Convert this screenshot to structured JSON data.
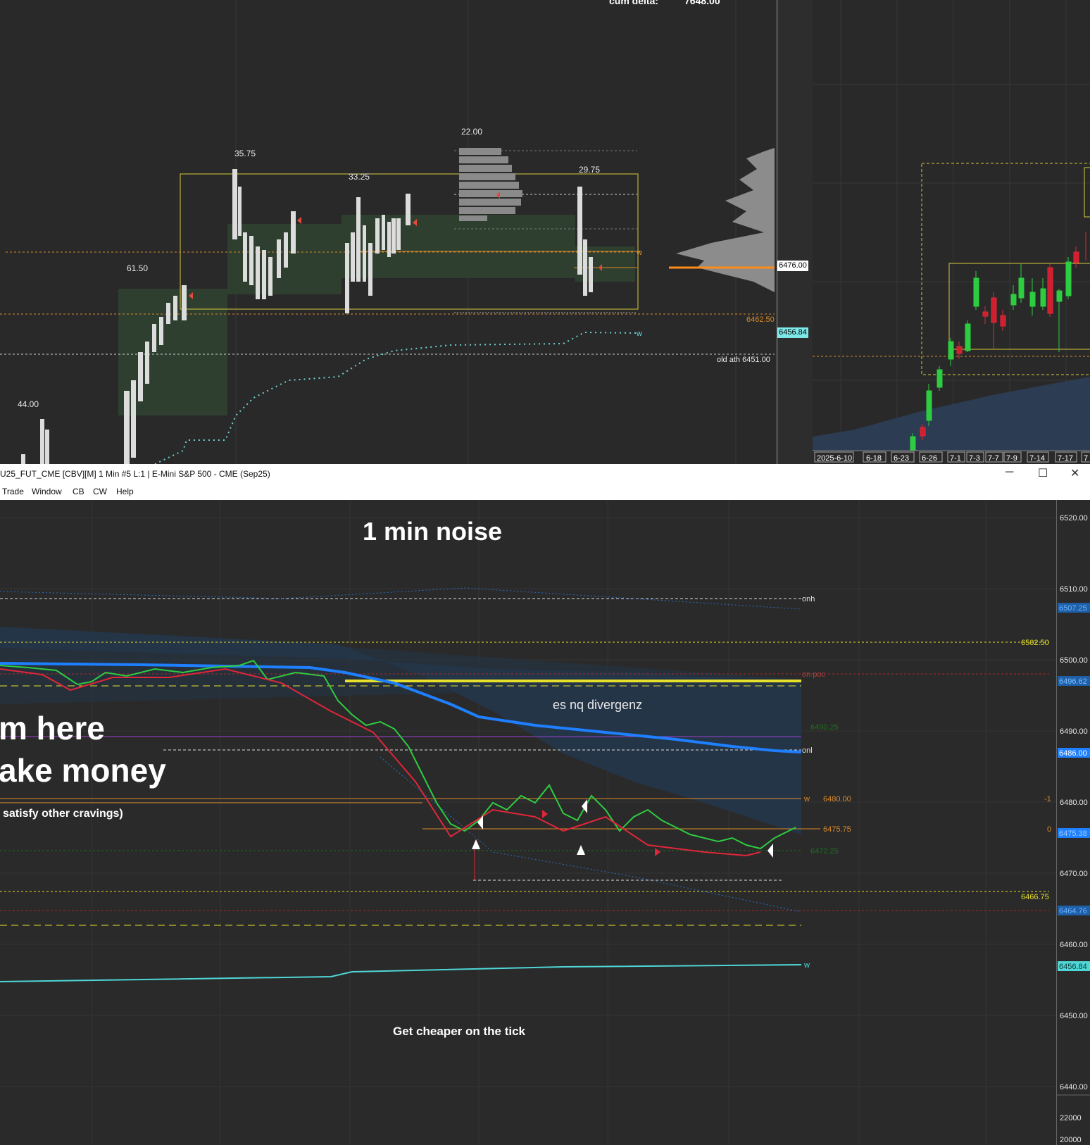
{
  "tpo_chart": {
    "cum_delta_label": "cum delta:",
    "cum_delta_value": "7648.00",
    "range_labels": [
      "35.75",
      "33.25",
      "22.00",
      "29.75",
      "61.50",
      "44.00"
    ],
    "price_tags": {
      "poc": "6476.00",
      "vwap": "6456.84"
    },
    "level_labels": {
      "level_6462": "6462.50",
      "old_ath": "old ath  6451.00"
    },
    "w_marker": "w"
  },
  "daily_chart": {
    "dates": [
      "2025-6-10",
      "6-18",
      "6-23",
      "6-26",
      "7-1",
      "7-3",
      "7-7",
      "7-9",
      "7-14",
      "7-17",
      "7"
    ]
  },
  "window": {
    "title": "U25_FUT_CME [CBV][M]  1 Min  #5 L:1 | E-Mini S&P 500 - CME (Sep25)",
    "menu": [
      "Trade",
      "Window",
      "CB",
      "CW",
      "Help"
    ],
    "buttons": {
      "minimize": "─",
      "maximize": "☐",
      "close": "✕"
    }
  },
  "main_chart": {
    "annotations": {
      "title": "1 min noise",
      "divergence": "es nq divergenz",
      "big_line1": "m here",
      "big_line2": "ake money",
      "cravings": "satisfy other cravings)",
      "bottom_note": "Get cheaper on the tick"
    },
    "line_labels": {
      "onh": "onh",
      "onpoc": "on poc",
      "onl": "onl",
      "w1": "w",
      "w2": "w",
      "l6480": "6480.00",
      "l6475": "6475.75",
      "l6490": "6490.25",
      "l6472": "6472.25",
      "neg1": "-1",
      "zero": "0"
    },
    "price_axis": {
      "ticks": [
        "6520.00",
        "6510.00",
        "6500.00",
        "6490.00",
        "6480.00",
        "6470.00",
        "6460.00",
        "6450.00",
        "6440.00"
      ],
      "tags": {
        "onh_tag": "6507.25",
        "t6502": "6502.50",
        "t6496": "6496.62",
        "t6486": "6486.00",
        "t6475": "6475.38",
        "t6466": "6466.75",
        "t6464": "6464.76",
        "t6456": "6456.84"
      },
      "volume_ticks": [
        "22000",
        "20000"
      ]
    }
  }
}
